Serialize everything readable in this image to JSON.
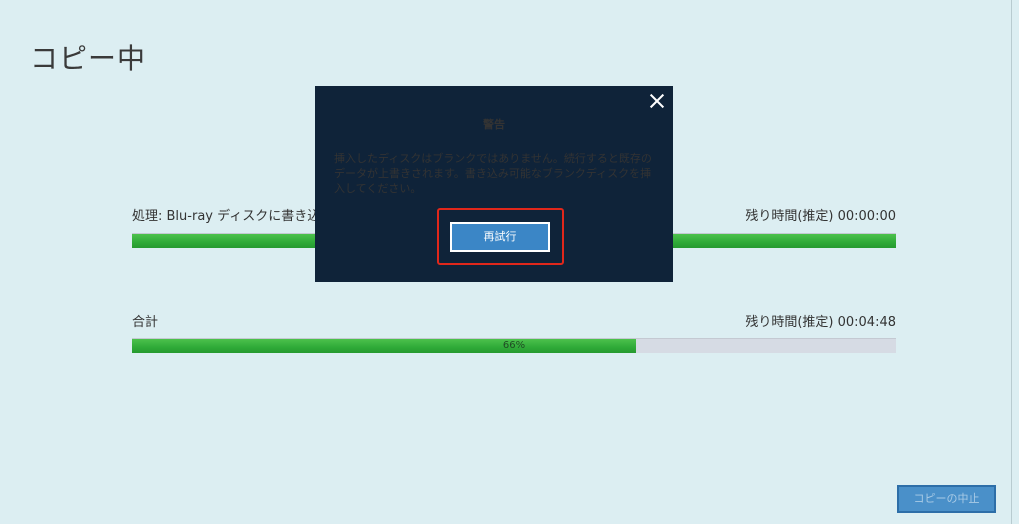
{
  "page": {
    "title": "コピー中"
  },
  "process_row": {
    "label": "処理: Blu-ray ディスクに書き込",
    "remaining": "残り時間(推定) 00:00:00",
    "progress": 1.0
  },
  "total_row": {
    "label": "合計",
    "remaining": "残り時間(推定) 00:04:48",
    "progress": 0.66,
    "progress_text": "66%"
  },
  "footer": {
    "stop_label": "コピーの中止"
  },
  "dialog": {
    "title": "警告",
    "message": "挿入したディスクはブランクではありません。続行すると既存のデータが上書きされます。書き込み可能なブランクディスクを挿入してください。",
    "retry_label": "再試行",
    "close_icon": "close-icon"
  },
  "colors": {
    "background": "#dceef2",
    "dialog_bg": "#0f2339",
    "progress_green": "#2faa38",
    "button_blue": "#3b86c6",
    "highlight_red": "#e0271b"
  }
}
